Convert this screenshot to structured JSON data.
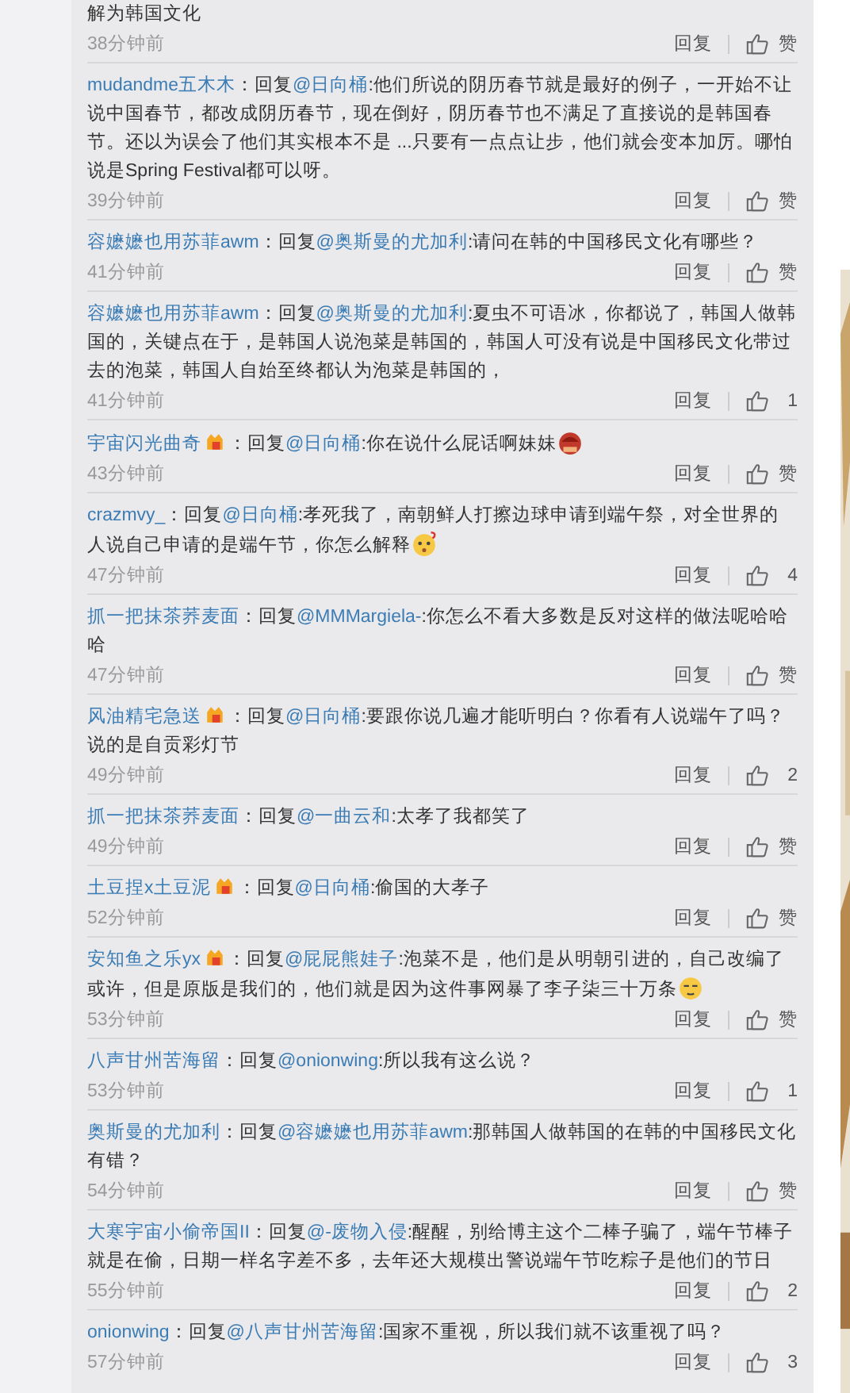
{
  "top_fragment": {
    "text": "解为韩国文化",
    "time": "38分钟前",
    "reply_action": "回复",
    "likes": "赞"
  },
  "comments": [
    {
      "user": "mudandme五木木",
      "badge": false,
      "sep": "：",
      "reply": "回复",
      "mention": "@日向桶",
      "body": ":他们所说的阴历春节就是最好的例子，一开始不让说中国春节，都改成阴历春节，现在倒好，阴历春节也不满足了直接说的是韩国春节。还以为误会了他们其实根本不是 ...只要有一点点让步，他们就会变本加厉。哪怕说是Spring Festival都可以呀。",
      "time": "39分钟前",
      "reply_action": "回复",
      "likes": "赞"
    },
    {
      "user": "容嬷嬷也用苏菲awm",
      "badge": false,
      "sep": "：",
      "reply": "回复",
      "mention": "@奥斯曼的尤加利",
      "body": ":请问在韩的中国移民文化有哪些？",
      "time": "41分钟前",
      "reply_action": "回复",
      "likes": "赞"
    },
    {
      "user": "容嬷嬷也用苏菲awm",
      "badge": false,
      "sep": "：",
      "reply": "回复",
      "mention": "@奥斯曼的尤加利",
      "body": ":夏虫不可语冰，你都说了，韩国人做韩国的，关键点在于，是韩国人说泡菜是韩国的，韩国人可没有说是中国移民文化带过去的泡菜，韩国人自始至终都认为泡菜是韩国的，",
      "time": "41分钟前",
      "reply_action": "回复",
      "likes": "1"
    },
    {
      "user": "宇宙闪光曲奇",
      "badge": true,
      "sep": "：",
      "reply": "回复",
      "mention": "@日向桶",
      "body": ":你在说什么屁话啊妹妹",
      "emoticon": {
        "kind": "angry"
      },
      "time": "43分钟前",
      "reply_action": "回复",
      "likes": "赞"
    },
    {
      "user": "crazmvy_",
      "badge": false,
      "sep": "：",
      "reply": "回复",
      "mention": "@日向桶",
      "body": ":孝死我了，南朝鲜人打擦边球申请到端午祭，对全世界的人说自己申请的是端午节，你怎么解释",
      "emoticon": {
        "kind": "puzzled"
      },
      "time": "47分钟前",
      "reply_action": "回复",
      "likes": "4"
    },
    {
      "user": "抓一把抹茶荞麦面",
      "badge": false,
      "sep": "：",
      "reply": "回复",
      "mention": "@MMMargiela-",
      "body": ":你怎么不看大多数是反对这样的做法呢哈哈哈",
      "time": "47分钟前",
      "reply_action": "回复",
      "likes": "赞"
    },
    {
      "user": "风油精宅急送",
      "badge": true,
      "sep": "：",
      "reply": "回复",
      "mention": "@日向桶",
      "body": ":要跟你说几遍才能听明白？你看有人说端午了吗？说的是自贡彩灯节",
      "time": "49分钟前",
      "reply_action": "回复",
      "likes": "2"
    },
    {
      "user": "抓一把抹茶荞麦面",
      "badge": false,
      "sep": "：",
      "reply": "回复",
      "mention": "@一曲云和",
      "body": ":太孝了我都笑了",
      "time": "49分钟前",
      "reply_action": "回复",
      "likes": "赞"
    },
    {
      "user": "土豆捏x土豆泥",
      "badge": true,
      "sep": "：",
      "reply": "回复",
      "mention": "@日向桶",
      "body": ":偷国的大孝子",
      "time": "52分钟前",
      "reply_action": "回复",
      "likes": "赞"
    },
    {
      "user": "安知鱼之乐yx",
      "badge": true,
      "sep": "：",
      "reply": "回复",
      "mention": "@屁屁熊娃子",
      "body": ":泡菜不是，他们是从明朝引进的，自己改编了或许，但是原版是我们的，他们就是因为这件事网暴了李子柒三十万条",
      "emoticon": {
        "kind": "smirk"
      },
      "time": "53分钟前",
      "reply_action": "回复",
      "likes": "赞"
    },
    {
      "user": "八声甘州苦海留",
      "badge": false,
      "sep": "：",
      "reply": "回复",
      "mention": "@onionwing",
      "body": ":所以我有这么说？",
      "time": "53分钟前",
      "reply_action": "回复",
      "likes": "1"
    },
    {
      "user": "奥斯曼的尤加利",
      "badge": false,
      "sep": "：",
      "reply": "回复",
      "mention": "@容嬷嬷也用苏菲awm",
      "body": ":那韩国人做韩国的在韩的中国移民文化有错？",
      "time": "54分钟前",
      "reply_action": "回复",
      "likes": "赞"
    },
    {
      "user": "大寒宇宙小偷帝国II",
      "badge": false,
      "sep": "：",
      "reply": "回复",
      "mention": "@-废物入侵",
      "body": ":醒醒，别给博主这个二棒子骗了，端午节棒子就是在偷，日期一样名字差不多，去年还大规模出警说端午节吃粽子是他们的节日",
      "time": "55分钟前",
      "reply_action": "回复",
      "likes": "2"
    },
    {
      "user": "onionwing",
      "badge": false,
      "sep": "：",
      "reply": "回复",
      "mention": "@八声甘州苦海留",
      "body": ":国家不重视，所以我们就不该重视了吗？",
      "time": "57分钟前",
      "reply_action": "回复",
      "likes": "3"
    }
  ]
}
